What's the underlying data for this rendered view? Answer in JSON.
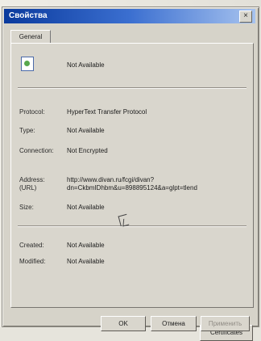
{
  "window": {
    "title": "Свойства",
    "close": "×"
  },
  "tabs": {
    "general": "General"
  },
  "properties": {
    "name_value": "Not Available",
    "protocol_label": "Protocol:",
    "protocol_value": "HyperText Transfer Protocol",
    "type_label": "Type:",
    "type_value": "Not Available",
    "connection_label": "Connection:",
    "connection_value": "Not Encrypted",
    "address_label_1": "Address:",
    "address_label_2": "(URL)",
    "address_value_1": "http://www.divan.ru/fcgi/divan?",
    "address_value_2": "dn=CkbmIDhbm&u=898895124&a=glpt=tlend",
    "size_label": "Size:",
    "size_value": "Not Available",
    "created_label": "Created:",
    "created_value": "Not Available",
    "modified_label": "Modified:",
    "modified_value": "Not Available"
  },
  "buttons": {
    "certificates": "Certificates",
    "ok": "OK",
    "cancel": "Отмена",
    "apply": "Применить"
  },
  "icons": {
    "file": "internet-file-icon",
    "cursor": "mouse-cursor-icon"
  }
}
